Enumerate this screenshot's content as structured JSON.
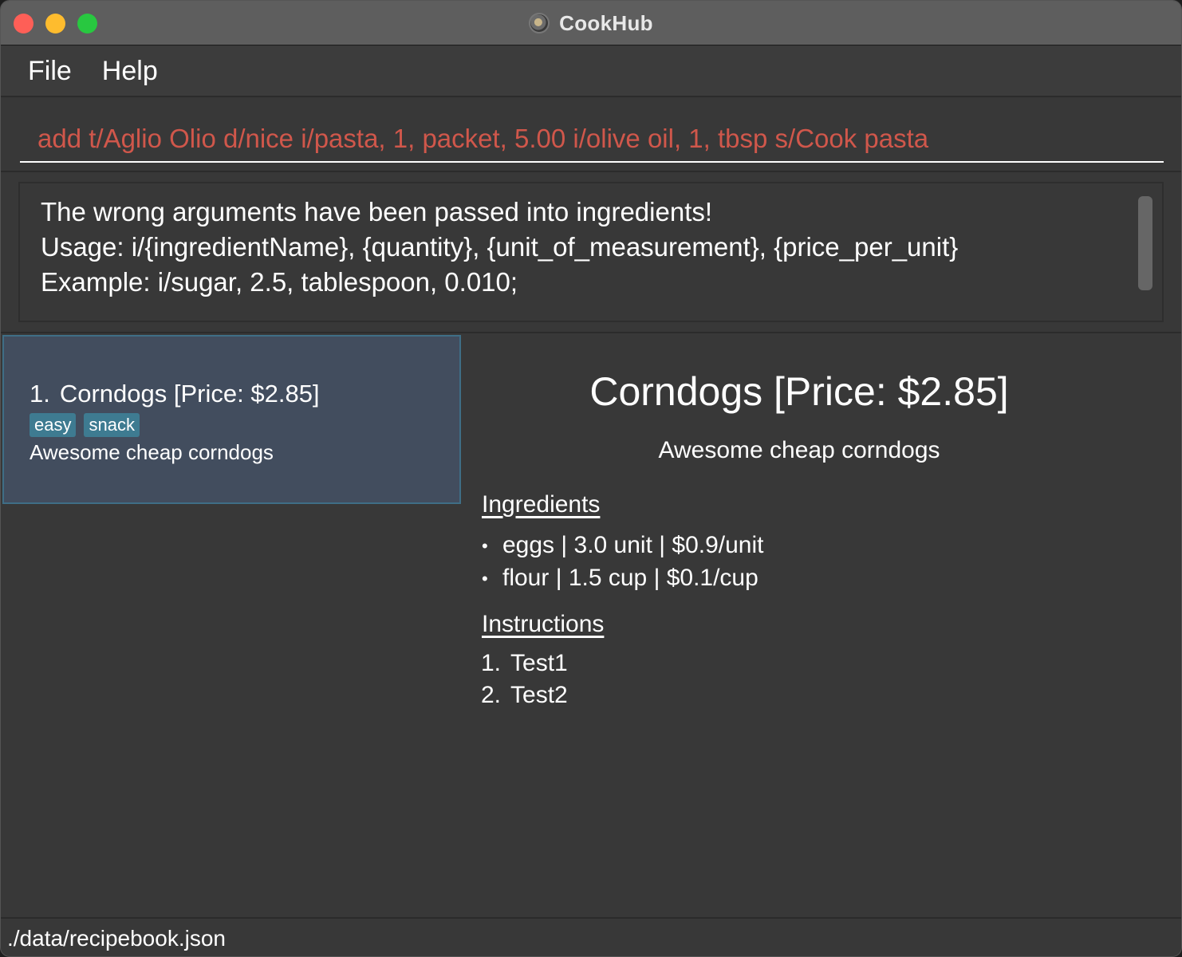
{
  "window": {
    "title": "CookHub",
    "icon": "cookhub-app-icon"
  },
  "menu": {
    "items": [
      "File",
      "Help"
    ]
  },
  "command_box": {
    "value": "add t/Aglio Olio d/nice i/pasta, 1, packet, 5.00 i/olive oil, 1, tbsp s/Cook pasta",
    "text_color": "#d0574b"
  },
  "result": {
    "lines": [
      "The wrong arguments have been passed into ingredients!",
      "Usage: i/{ingredientName}, {quantity}, {unit_of_measurement}, {price_per_unit}",
      "Example: i/sugar, 2.5, tablespoon, 0.010;"
    ]
  },
  "recipe_list": [
    {
      "index": "1.",
      "title": "Corndogs [Price: $2.85]",
      "tags": [
        "easy",
        "snack"
      ],
      "description": "Awesome cheap corndogs"
    }
  ],
  "detail": {
    "title": "Corndogs [Price: $2.85]",
    "description": "Awesome cheap corndogs",
    "ingredients_heading": "Ingredients",
    "ingredients": [
      "eggs | 3.0 unit | $0.9/unit",
      "flour | 1.5 cup | $0.1/cup"
    ],
    "instructions_heading": "Instructions",
    "instructions": [
      {
        "num": "1.",
        "text": "Test1"
      },
      {
        "num": "2.",
        "text": "Test2"
      }
    ]
  },
  "status_bar": {
    "path": "./data/recipebook.json"
  },
  "colors": {
    "selected_card_bg": "#424d5e",
    "selected_card_border": "#3f6e86",
    "tag_bg": "#3e7b91"
  }
}
